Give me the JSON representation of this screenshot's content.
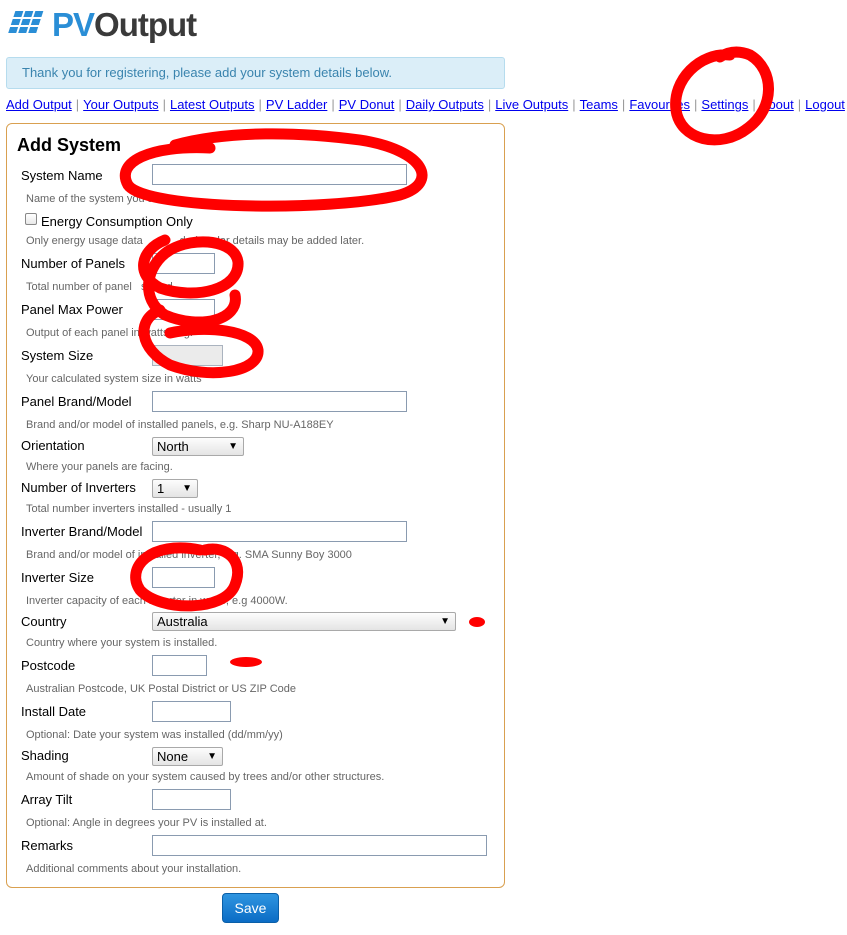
{
  "brand": {
    "logo_pv": "PV",
    "logo_output": "Output"
  },
  "notice": "Thank you for registering, please add your system details below.",
  "nav": [
    "Add Output",
    "Your Outputs",
    "Latest Outputs",
    "PV Ladder",
    "PV Donut",
    "Daily Outputs",
    "Live Outputs",
    "Teams",
    "Favourites",
    "Settings",
    "About",
    "Logout"
  ],
  "form": {
    "title": "Add System",
    "system_name": {
      "label": "System Name",
      "help": "Name of the system you are"
    },
    "energy_only": {
      "label": "Energy Consumption Only",
      "help": "Only energy usage data            ded. Solar details may be added later."
    },
    "panels": {
      "label": "Number of Panels",
      "help": "Total number of panel   stalled"
    },
    "panel_power": {
      "label": "Panel Max Power",
      "help": "Output of each panel in watts, e.g."
    },
    "system_size": {
      "label": "System Size",
      "help": "Your calculated system size in watts"
    },
    "panel_brand": {
      "label": "Panel Brand/Model",
      "help": "Brand and/or model of installed panels, e.g. Sharp NU-A188EY"
    },
    "orientation": {
      "label": "Orientation",
      "value": "North",
      "help": "Where your panels are facing."
    },
    "inverters": {
      "label": "Number of Inverters",
      "value": "1",
      "help": "Total number inverters installed - usually 1"
    },
    "inverter_brand": {
      "label": "Inverter Brand/Model",
      "help": "Brand and/or model of installed inverter, e.g. SMA Sunny Boy 3000"
    },
    "inverter_size": {
      "label": "Inverter Size",
      "help": "Inverter capacity of each inverter in watts, e.g 4000W."
    },
    "country": {
      "label": "Country",
      "value": "Australia",
      "help": "Country where your system is installed."
    },
    "postcode": {
      "label": "Postcode",
      "help": "Australian Postcode, UK Postal District or US ZIP Code"
    },
    "install_date": {
      "label": "Install Date",
      "help": "Optional: Date your system was installed (dd/mm/yy)"
    },
    "shading": {
      "label": "Shading",
      "value": "None",
      "help": "Amount of shade on your system caused by trees and/or other structures."
    },
    "array_tilt": {
      "label": "Array Tilt",
      "help": "Optional: Angle in degrees your PV is installed at."
    },
    "remarks": {
      "label": "Remarks",
      "help": "Additional comments about your installation."
    },
    "save": "Save"
  },
  "colors": {
    "accent": "#2a8ed6",
    "panel_border": "#d9a050",
    "annotation": "#ff0000"
  }
}
